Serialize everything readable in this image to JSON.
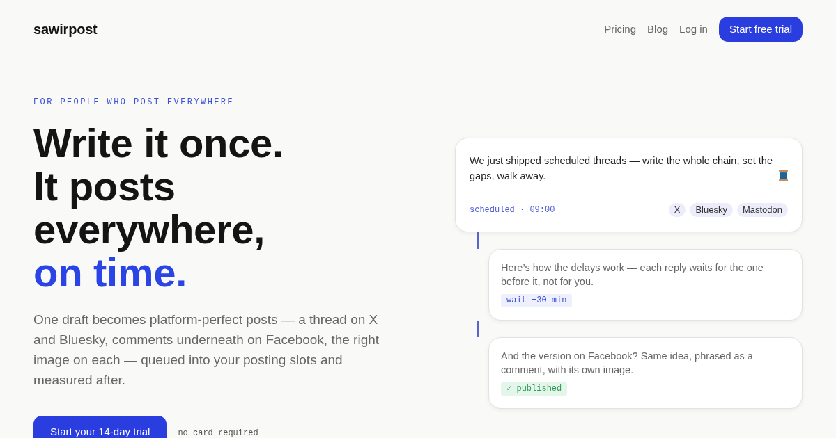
{
  "header": {
    "logo": "sawirpost",
    "nav_links": [
      "Pricing",
      "Blog",
      "Log in"
    ],
    "cta": "Start free trial"
  },
  "hero": {
    "eyebrow": "FOR PEOPLE WHO POST EVERYWHERE",
    "headline": {
      "lines": [
        "Write it once.",
        "It posts",
        "everywhere,"
      ],
      "accent": "on time."
    },
    "description": "One draft becomes platform-perfect posts — a thread on X and Bluesky, comments underneath on Facebook, the right image on each — queued into your posting slots and measured after.",
    "cta": "Start your 14-day trial",
    "note": "no card required"
  },
  "thread": {
    "post": {
      "text": "We just shipped scheduled threads — write the whole chain, set the gaps, walk away.",
      "schedule": "scheduled · 09:00",
      "platforms": [
        "X",
        "Bluesky",
        "Mastodon"
      ]
    },
    "replies": [
      {
        "text": "Here’s how the delays work — each reply waits for the one before it, not for you.",
        "status": "wait +30 min",
        "kind": "wait"
      },
      {
        "text": "And the version on Facebook? Same idea, phrased as a comment, with its own image.",
        "status": "✓ published",
        "kind": "published"
      }
    ]
  }
}
